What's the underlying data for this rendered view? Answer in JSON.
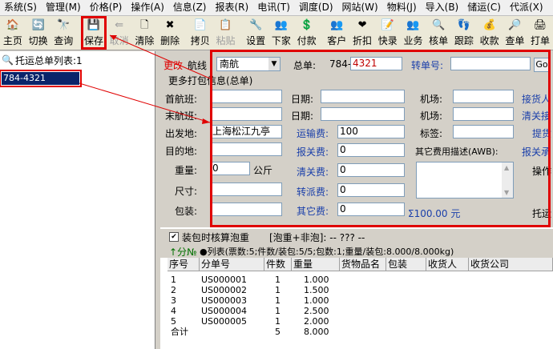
{
  "menu": [
    "系统(S)",
    "管理(M)",
    "价格(P)",
    "操作(A)",
    "信息(Z)",
    "报表(R)",
    "电讯(T)",
    "调度(D)",
    "网站(W)",
    "物料(J)",
    "导入(B)",
    "储运(C)",
    "代派(X)"
  ],
  "toolbar": [
    {
      "label": "主页",
      "icon": "🏠"
    },
    {
      "label": "切换",
      "icon": "🔄"
    },
    {
      "label": "查询",
      "icon": "🔭"
    },
    {
      "label": "保存",
      "icon": "💾"
    },
    {
      "label": "取消",
      "icon": "⇚"
    },
    {
      "label": "清除",
      "icon": "🗋"
    },
    {
      "label": "删除",
      "icon": "✖"
    },
    {
      "label": "拷贝",
      "icon": "📄"
    },
    {
      "label": "粘贴",
      "icon": "📋"
    },
    {
      "label": "设置",
      "icon": "🔧"
    },
    {
      "label": "下家",
      "icon": "👥"
    },
    {
      "label": "付款",
      "icon": "💲"
    },
    {
      "label": "客户",
      "icon": "👥"
    },
    {
      "label": "折扣",
      "icon": "❤"
    },
    {
      "label": "快录",
      "icon": "📝"
    },
    {
      "label": "业务",
      "icon": "👥"
    },
    {
      "label": "核单",
      "icon": "🔍"
    },
    {
      "label": "跟踪",
      "icon": "👣"
    },
    {
      "label": "收款",
      "icon": "💰"
    },
    {
      "label": "查单",
      "icon": "🔎"
    },
    {
      "label": "打单",
      "icon": "🖨"
    }
  ],
  "left_panel": {
    "title": "托运总单列表:1",
    "item": "784-4321"
  },
  "form": {
    "change_label": "更改",
    "airline_label": "航线",
    "airline_value": "南航",
    "master_label": "总单:",
    "master_prefix": "784-",
    "master_value": "4321",
    "transfer_label": "转单号:",
    "go_label": "Go",
    "section_title": "更多打包信息(总单)",
    "first_flight": "首航班:",
    "last_flight": "末航班:",
    "date1": "日期:",
    "date2": "日期:",
    "airport1": "机场:",
    "airport2": "机场:",
    "origin_label": "出发地:",
    "origin_value": "上海松江九亭",
    "dest_label": "目的地:",
    "weight_label": "重量:",
    "weight_value": "0",
    "weight_unit": "公斤",
    "size_label": "尺寸:",
    "pack_label": "包装:",
    "freight_label": "运输费:",
    "freight_value": "100",
    "customs_label": "报关费:",
    "customs_value": "0",
    "clear_label": "清关费:",
    "clear_value": "0",
    "delivery_label": "转派费:",
    "delivery_value": "0",
    "other_label": "其它费:",
    "other_value": "0",
    "tag_label": "标签:",
    "other_desc_label": "其它费用描述(AWB):",
    "total_value": "Σ100.00 元",
    "right_labels": [
      "接货人",
      "清关接",
      "提货",
      "报关承",
      "操作",
      "托运"
    ]
  },
  "options": {
    "check_label": "装包时核算泡重",
    "vol_label": "[泡重+非泡]: -- ??? --",
    "sub_label": "↑分№",
    "list_label": "●列表(票数:5;件数/装包:5/5;包数:1;重量/装包:8.000/8.000kg)"
  },
  "table": {
    "headers": [
      "序号",
      "分单号",
      "件数",
      "重量",
      "货物品名",
      "包装",
      "收货人",
      "收货公司"
    ],
    "rows": [
      [
        "1",
        "US000001",
        "1",
        "1.000"
      ],
      [
        "2",
        "US000002",
        "1",
        "1.500"
      ],
      [
        "3",
        "US000003",
        "1",
        "1.000"
      ],
      [
        "4",
        "US000004",
        "1",
        "2.500"
      ],
      [
        "5",
        "US000005",
        "1",
        "2.000"
      ]
    ],
    "total": [
      "合计",
      "",
      "5",
      "8.000"
    ]
  }
}
